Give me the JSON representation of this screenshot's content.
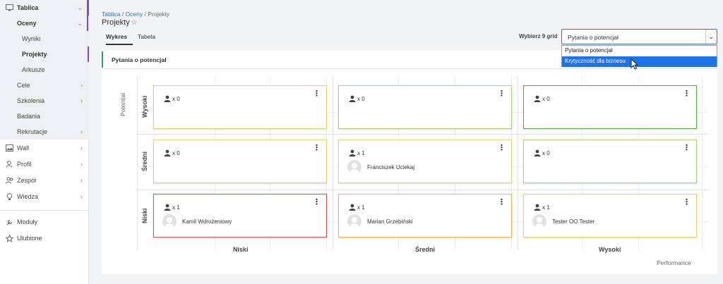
{
  "sidebar": {
    "items": [
      {
        "label": "Tablica",
        "icon": "monitor-icon",
        "chevron": "⌄"
      },
      {
        "label": "Oceny",
        "chevron": "⌄"
      },
      {
        "label": "Wyniki"
      },
      {
        "label": "Projekty"
      },
      {
        "label": "Arkusze"
      },
      {
        "label": "Cele",
        "chevron": "›"
      },
      {
        "label": "Szkolenia",
        "chevron": "›"
      },
      {
        "label": "Badania"
      },
      {
        "label": "Rekrutacje",
        "chevron": "›"
      },
      {
        "label": "Wall",
        "icon": "image-icon",
        "chevron": "›"
      },
      {
        "label": "Profil",
        "icon": "user-icon",
        "chevron": "›"
      },
      {
        "label": "Zespół",
        "icon": "users-icon",
        "chevron": "›"
      },
      {
        "label": "Wiedza",
        "icon": "lightbulb-icon",
        "chevron": "›"
      },
      {
        "label": "Moduły",
        "icon": "wrench-icon"
      },
      {
        "label": "Ulubione",
        "icon": "star-icon"
      }
    ]
  },
  "breadcrumb": {
    "first": "Tablica",
    "sep1": " / ",
    "second": "Oceny",
    "sep2": " / ",
    "current": "Projekty"
  },
  "page": {
    "title": "Projekty",
    "star_glyph": "☆"
  },
  "tabs": [
    {
      "label": "Wykres",
      "active": true
    },
    {
      "label": "Tabela",
      "active": false
    }
  ],
  "grid_select": {
    "label": "Wybierz 9 grid",
    "value": "Pytania o potencjał",
    "chevron": "⌄",
    "options": [
      {
        "label": "Pytania o potencjał",
        "selected": false
      },
      {
        "label": "Krytyczność dla biznesu",
        "selected": true
      }
    ]
  },
  "panel": {
    "title": "Pytania o potencjał",
    "y_axis_title": "Potential",
    "x_axis_title": "Performance",
    "row_labels": [
      "Wysoki",
      "Średni",
      "Niski"
    ],
    "col_labels": [
      "Niski",
      "Średni",
      "Wysoki"
    ],
    "cells": [
      [
        {
          "count": "x 0",
          "border": "#e8d36a",
          "employees": []
        },
        {
          "count": "x 0",
          "border": "#a6d27a",
          "employees": []
        },
        {
          "count": "x 0",
          "border": "#5aa64a",
          "employees": []
        }
      ],
      [
        {
          "count": "x 0",
          "border": "#e8d36a",
          "employees": []
        },
        {
          "count": "x 1",
          "border": "#e8d36a",
          "employees": [
            "Franciszek Uciekaj"
          ]
        },
        {
          "count": "x 0",
          "border": "#a6d27a",
          "employees": []
        }
      ],
      [
        {
          "count": "x 1",
          "border": "#d9505a",
          "employees": [
            "Kamil Wdrożeniowy"
          ]
        },
        {
          "count": "x 1",
          "border": "#f0b84a",
          "employees": [
            "Marian Grzebiński"
          ]
        },
        {
          "count": "x 1",
          "border": "#e8d36a",
          "employees": [
            "Tester OO Tester"
          ]
        }
      ]
    ],
    "menu_glyph": "⋮"
  },
  "colors": {
    "accent_purple": "#7b4dd6",
    "link_blue": "#2a6fbf",
    "green_accent": "#27a36a",
    "select_blue": "#1e73e8"
  }
}
